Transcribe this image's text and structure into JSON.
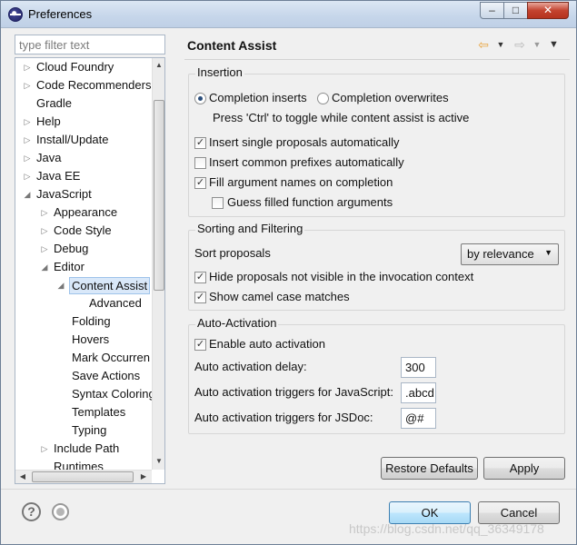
{
  "window": {
    "title": "Preferences"
  },
  "filter": {
    "placeholder": "type filter text"
  },
  "tree": {
    "items": [
      {
        "label": "Cloud Foundry",
        "arrow": "▷"
      },
      {
        "label": "Code Recommenders",
        "arrow": "▷"
      },
      {
        "label": "Gradle",
        "arrow": ""
      },
      {
        "label": "Help",
        "arrow": "▷"
      },
      {
        "label": "Install/Update",
        "arrow": "▷"
      },
      {
        "label": "Java",
        "arrow": "▷"
      },
      {
        "label": "Java EE",
        "arrow": "▷"
      },
      {
        "label": "JavaScript",
        "arrow": "◢"
      },
      {
        "label": "Appearance",
        "arrow": "▷"
      },
      {
        "label": "Code Style",
        "arrow": "▷"
      },
      {
        "label": "Debug",
        "arrow": "▷"
      },
      {
        "label": "Editor",
        "arrow": "◢"
      },
      {
        "label": "Content Assist",
        "arrow": "◢"
      },
      {
        "label": "Advanced",
        "arrow": ""
      },
      {
        "label": "Folding",
        "arrow": ""
      },
      {
        "label": "Hovers",
        "arrow": ""
      },
      {
        "label": "Mark Occurren",
        "arrow": ""
      },
      {
        "label": "Save Actions",
        "arrow": ""
      },
      {
        "label": "Syntax Coloring",
        "arrow": ""
      },
      {
        "label": "Templates",
        "arrow": ""
      },
      {
        "label": "Typing",
        "arrow": ""
      },
      {
        "label": "Include Path",
        "arrow": "▷"
      },
      {
        "label": "Runtimes",
        "arrow": ""
      }
    ],
    "selected": "Content Assist"
  },
  "page": {
    "title": "Content Assist"
  },
  "insertion": {
    "title": "Insertion",
    "radio_inserts": "Completion inserts",
    "radio_overwrites": "Completion overwrites",
    "hint": "Press 'Ctrl' to toggle while content assist is active",
    "opt_single": "Insert single proposals automatically",
    "opt_prefixes": "Insert common prefixes automatically",
    "opt_fill": "Fill argument names on completion",
    "opt_guess": "Guess filled function arguments"
  },
  "sorting": {
    "title": "Sorting and Filtering",
    "sort_label": "Sort proposals",
    "sort_value": "by relevance",
    "opt_hide": "Hide proposals not visible in the invocation context",
    "opt_camel": "Show camel case matches"
  },
  "activation": {
    "title": "Auto-Activation",
    "opt_enable": "Enable auto activation",
    "delay_label": "Auto activation delay:",
    "delay_value": "300",
    "js_label": "Auto activation triggers for JavaScript:",
    "js_value": ".abcd",
    "jsdoc_label": "Auto activation triggers for JSDoc:",
    "jsdoc_value": "@#"
  },
  "buttons": {
    "restore": "Restore Defaults",
    "apply": "Apply",
    "ok": "OK",
    "cancel": "Cancel"
  },
  "checkmark": "✓",
  "watermark": "https://blog.csdn.net/qq_36349178",
  "icons": {
    "back": "back-arrow-icon",
    "forward": "forward-arrow-icon",
    "menu": "view-menu-icon",
    "help": "help-icon",
    "import": "import-export-icon"
  },
  "colors": {
    "selection": "#d9e8f9",
    "back_arrow": "#e8a33d",
    "ok_button": "#bee6fd"
  }
}
